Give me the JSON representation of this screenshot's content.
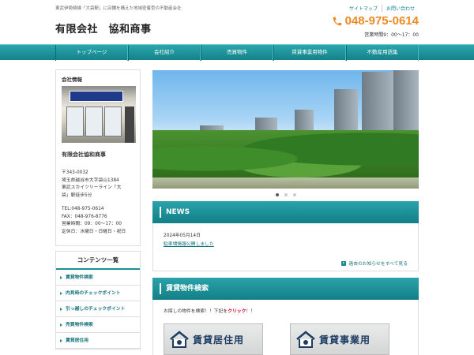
{
  "header": {
    "tagline": "東武伊勢崎線「大袋駅」に店舗を構えた地域密着型の不動産会社",
    "logo": "有限会社　協和商事",
    "links": [
      "サイトマップ",
      "お問い合わせ"
    ],
    "phone": "048-975-0614",
    "hours": "営業時間9：00～17：00",
    "phone_color": "#ef8a22"
  },
  "nav": {
    "items": [
      "トップページ",
      "会社紹介",
      "売買物件",
      "賃貸事業用物件",
      "不動産用語集"
    ]
  },
  "sidebar": {
    "company_heading": "会社情報",
    "company_name": "有限会社協和商事",
    "address_lines": [
      "〒343-0032",
      "埼玉県越谷市大字袋山1384",
      "東武スカイツリーライン「大",
      "袋」駅徒歩5分"
    ],
    "contact_lines": [
      "TEL:048-975-0614",
      "FAX：048-976-8776",
      "営業時間：09：00～17：00",
      "定休日：水曜日・日曜日・祝日"
    ],
    "contents_heading": "コンテンツ一覧",
    "contents_items": [
      "賃貸物件検索",
      "内見時のチェックポイント",
      "引っ越しのチェックポイント",
      "売買物件検索",
      "賃貸居住用"
    ]
  },
  "main": {
    "slider_dots": 3,
    "slider_active": 0,
    "news": {
      "heading": "NEWS",
      "date": "2024年05月14日",
      "link": "駐車場情報公開しました",
      "more": "過去のお知らせをすべて見る"
    },
    "search": {
      "heading": "賃貸物件検索",
      "text_before": "お探しの物件を検索！！下記を",
      "text_emphasis": "クリック",
      "text_after": "！！",
      "cards": [
        "賃貸居住用",
        "賃貸事業用"
      ]
    }
  },
  "accent_color": "#1a8f96"
}
